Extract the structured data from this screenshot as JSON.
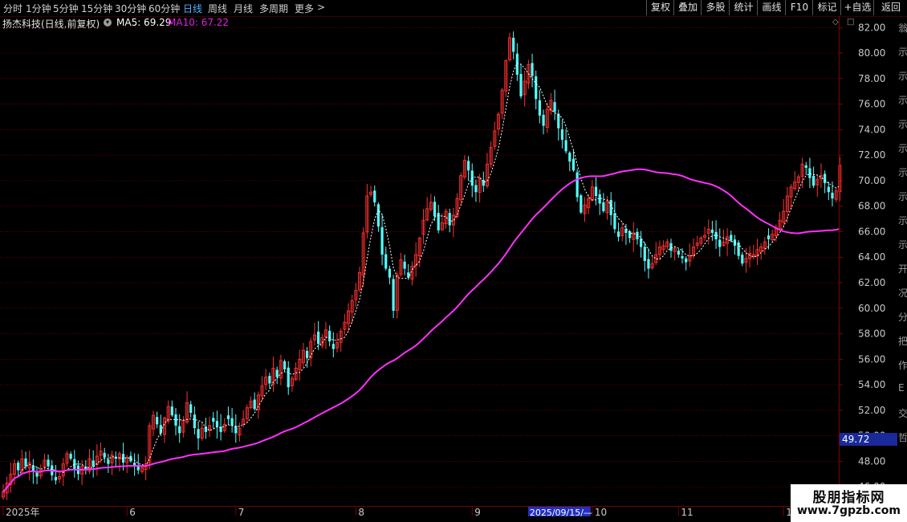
{
  "toolbar": {
    "periods": [
      "分时",
      "1分钟",
      "5分钟",
      "15分钟",
      "30分钟",
      "60分钟",
      "日线",
      "周线",
      "月线",
      "多周期",
      "更多"
    ],
    "active_period": "日线",
    "more_arrow": ">",
    "tools": [
      "复权",
      "叠加",
      "多股",
      "统计",
      "画线",
      "F10",
      "标记",
      "+自选",
      "返回"
    ]
  },
  "legend": {
    "stock_name": "扬杰科技(日线,前复权)",
    "ma5": "MA5: 69.29",
    "ma10": "MA10: 67.22"
  },
  "current_price_tag": "49.72",
  "cursor_date": "2025/09/15/—",
  "side_panel_chars": [
    "翁",
    "示",
    "示",
    "示",
    "示",
    "示",
    "示",
    "示",
    "示",
    "示",
    "开",
    "况",
    "分",
    "把",
    "作",
    "E",
    "交",
    "哲"
  ],
  "watermark": {
    "line1": "股朋指标网",
    "line2": "www.7gpzb.com"
  },
  "colors": {
    "up": "#ff3030",
    "down": "#54ffff",
    "ma_short": "#ffffff",
    "ma_long": "#ff30ff",
    "grid": "#8b0000",
    "axis_text": "#c8c8c8",
    "tag_bg": "#1a2a9a"
  },
  "chart_data": {
    "type": "candlestick",
    "ylim": [
      44.5,
      82.9
    ],
    "y_ticks": [
      46.0,
      48.0,
      50.0,
      52.0,
      54.0,
      56.0,
      58.0,
      60.0,
      62.0,
      64.0,
      66.0,
      68.0,
      70.0,
      72.0,
      74.0,
      76.0,
      78.0,
      80.0,
      82.0
    ],
    "y_tick_labels": [
      "46.00",
      "48.00",
      "50.00",
      "52.00",
      "54.00",
      "56.00",
      "58.00",
      "60.00",
      "62.00",
      "64.00",
      "66.00",
      "68.00",
      "70.00",
      "72.00",
      "74.00",
      "76.00",
      "78.00",
      "80.00",
      "82.00"
    ],
    "x_labels": [
      "2025年",
      "6",
      "7",
      "8",
      "9",
      "10",
      "11",
      "12"
    ],
    "x_label_days": [
      0,
      33,
      62,
      94,
      125,
      157,
      180,
      208
    ],
    "closes": [
      45.6,
      46.3,
      47.0,
      47.8,
      47.3,
      48.2,
      47.6,
      47.9,
      47.2,
      46.8,
      47.4,
      48.1,
      47.6,
      46.9,
      46.5,
      46.8,
      47.8,
      48.6,
      48.2,
      47.4,
      47.0,
      47.6,
      47.3,
      48.2,
      47.6,
      48.4,
      48.8,
      48.3,
      47.8,
      48.5,
      48.2,
      48.6,
      47.9,
      48.3,
      48.0,
      47.6,
      47.3,
      47.5,
      47.8,
      50.8,
      51.6,
      50.9,
      50.2,
      51.4,
      52.3,
      51.6,
      50.8,
      50.2,
      51.2,
      52.6,
      51.8,
      50.6,
      49.8,
      50.6,
      50.3,
      50.8,
      51.1,
      50.7,
      50.3,
      50.9,
      51.3,
      50.8,
      50.2,
      50.6,
      51.3,
      52.2,
      52.7,
      52.1,
      53.2,
      53.9,
      54.6,
      54.1,
      55.3,
      54.6,
      55.9,
      55.2,
      53.8,
      54.5,
      55.3,
      56.0,
      56.7,
      56.1,
      57.4,
      57.9,
      57.2,
      57.7,
      58.3,
      57.4,
      56.8,
      57.3,
      58.2,
      58.9,
      59.8,
      60.6,
      61.4,
      62.8,
      65.9,
      68.8,
      69.1,
      68.3,
      66.4,
      64.2,
      63.1,
      62.4,
      59.8,
      62.6,
      63.8,
      63.1,
      62.4,
      63.3,
      64.2,
      65.5,
      66.9,
      67.8,
      68.3,
      67.2,
      66.1,
      66.7,
      67.6,
      66.5,
      67.3,
      68.6,
      70.4,
      71.6,
      70.8,
      69.6,
      69.1,
      70.2,
      69.6,
      71.3,
      72.6,
      73.9,
      75.2,
      77.1,
      79.4,
      81.2,
      80.1,
      78.3,
      76.6,
      77.8,
      79.1,
      78.2,
      76.4,
      75.1,
      74.3,
      75.6,
      76.3,
      75.4,
      74.1,
      73.2,
      72.3,
      71.5,
      70.8,
      68.7,
      67.5,
      68.1,
      68.6,
      69.5,
      68.8,
      68.2,
      67.6,
      68.4,
      67.3,
      66.2,
      65.6,
      66.3,
      65.9,
      65.5,
      65.9,
      65.4,
      64.8,
      63.7,
      63.1,
      63.5,
      64.2,
      64.8,
      64.9,
      65.2,
      64.5,
      64.7,
      64.2,
      63.9,
      63.6,
      64.1,
      64.8,
      65.1,
      65.5,
      65.7,
      66.2,
      65.9,
      65.4,
      64.8,
      65.2,
      65.6,
      65.3,
      64.9,
      64.1,
      63.5,
      63.9,
      64.3,
      64.2,
      64.6,
      64.8,
      65.2,
      65.4,
      65.8,
      66.3,
      66.9,
      67.6,
      68.8,
      69.5,
      69.9,
      70.3,
      71.3,
      71.0,
      70.2,
      69.6,
      70.1,
      70.4,
      69.8,
      69.1,
      68.6,
      69.2,
      71.2
    ],
    "series": [
      {
        "name": "MA5",
        "values": [
          69.29
        ]
      },
      {
        "name": "MA10",
        "values": [
          67.22
        ]
      }
    ]
  }
}
